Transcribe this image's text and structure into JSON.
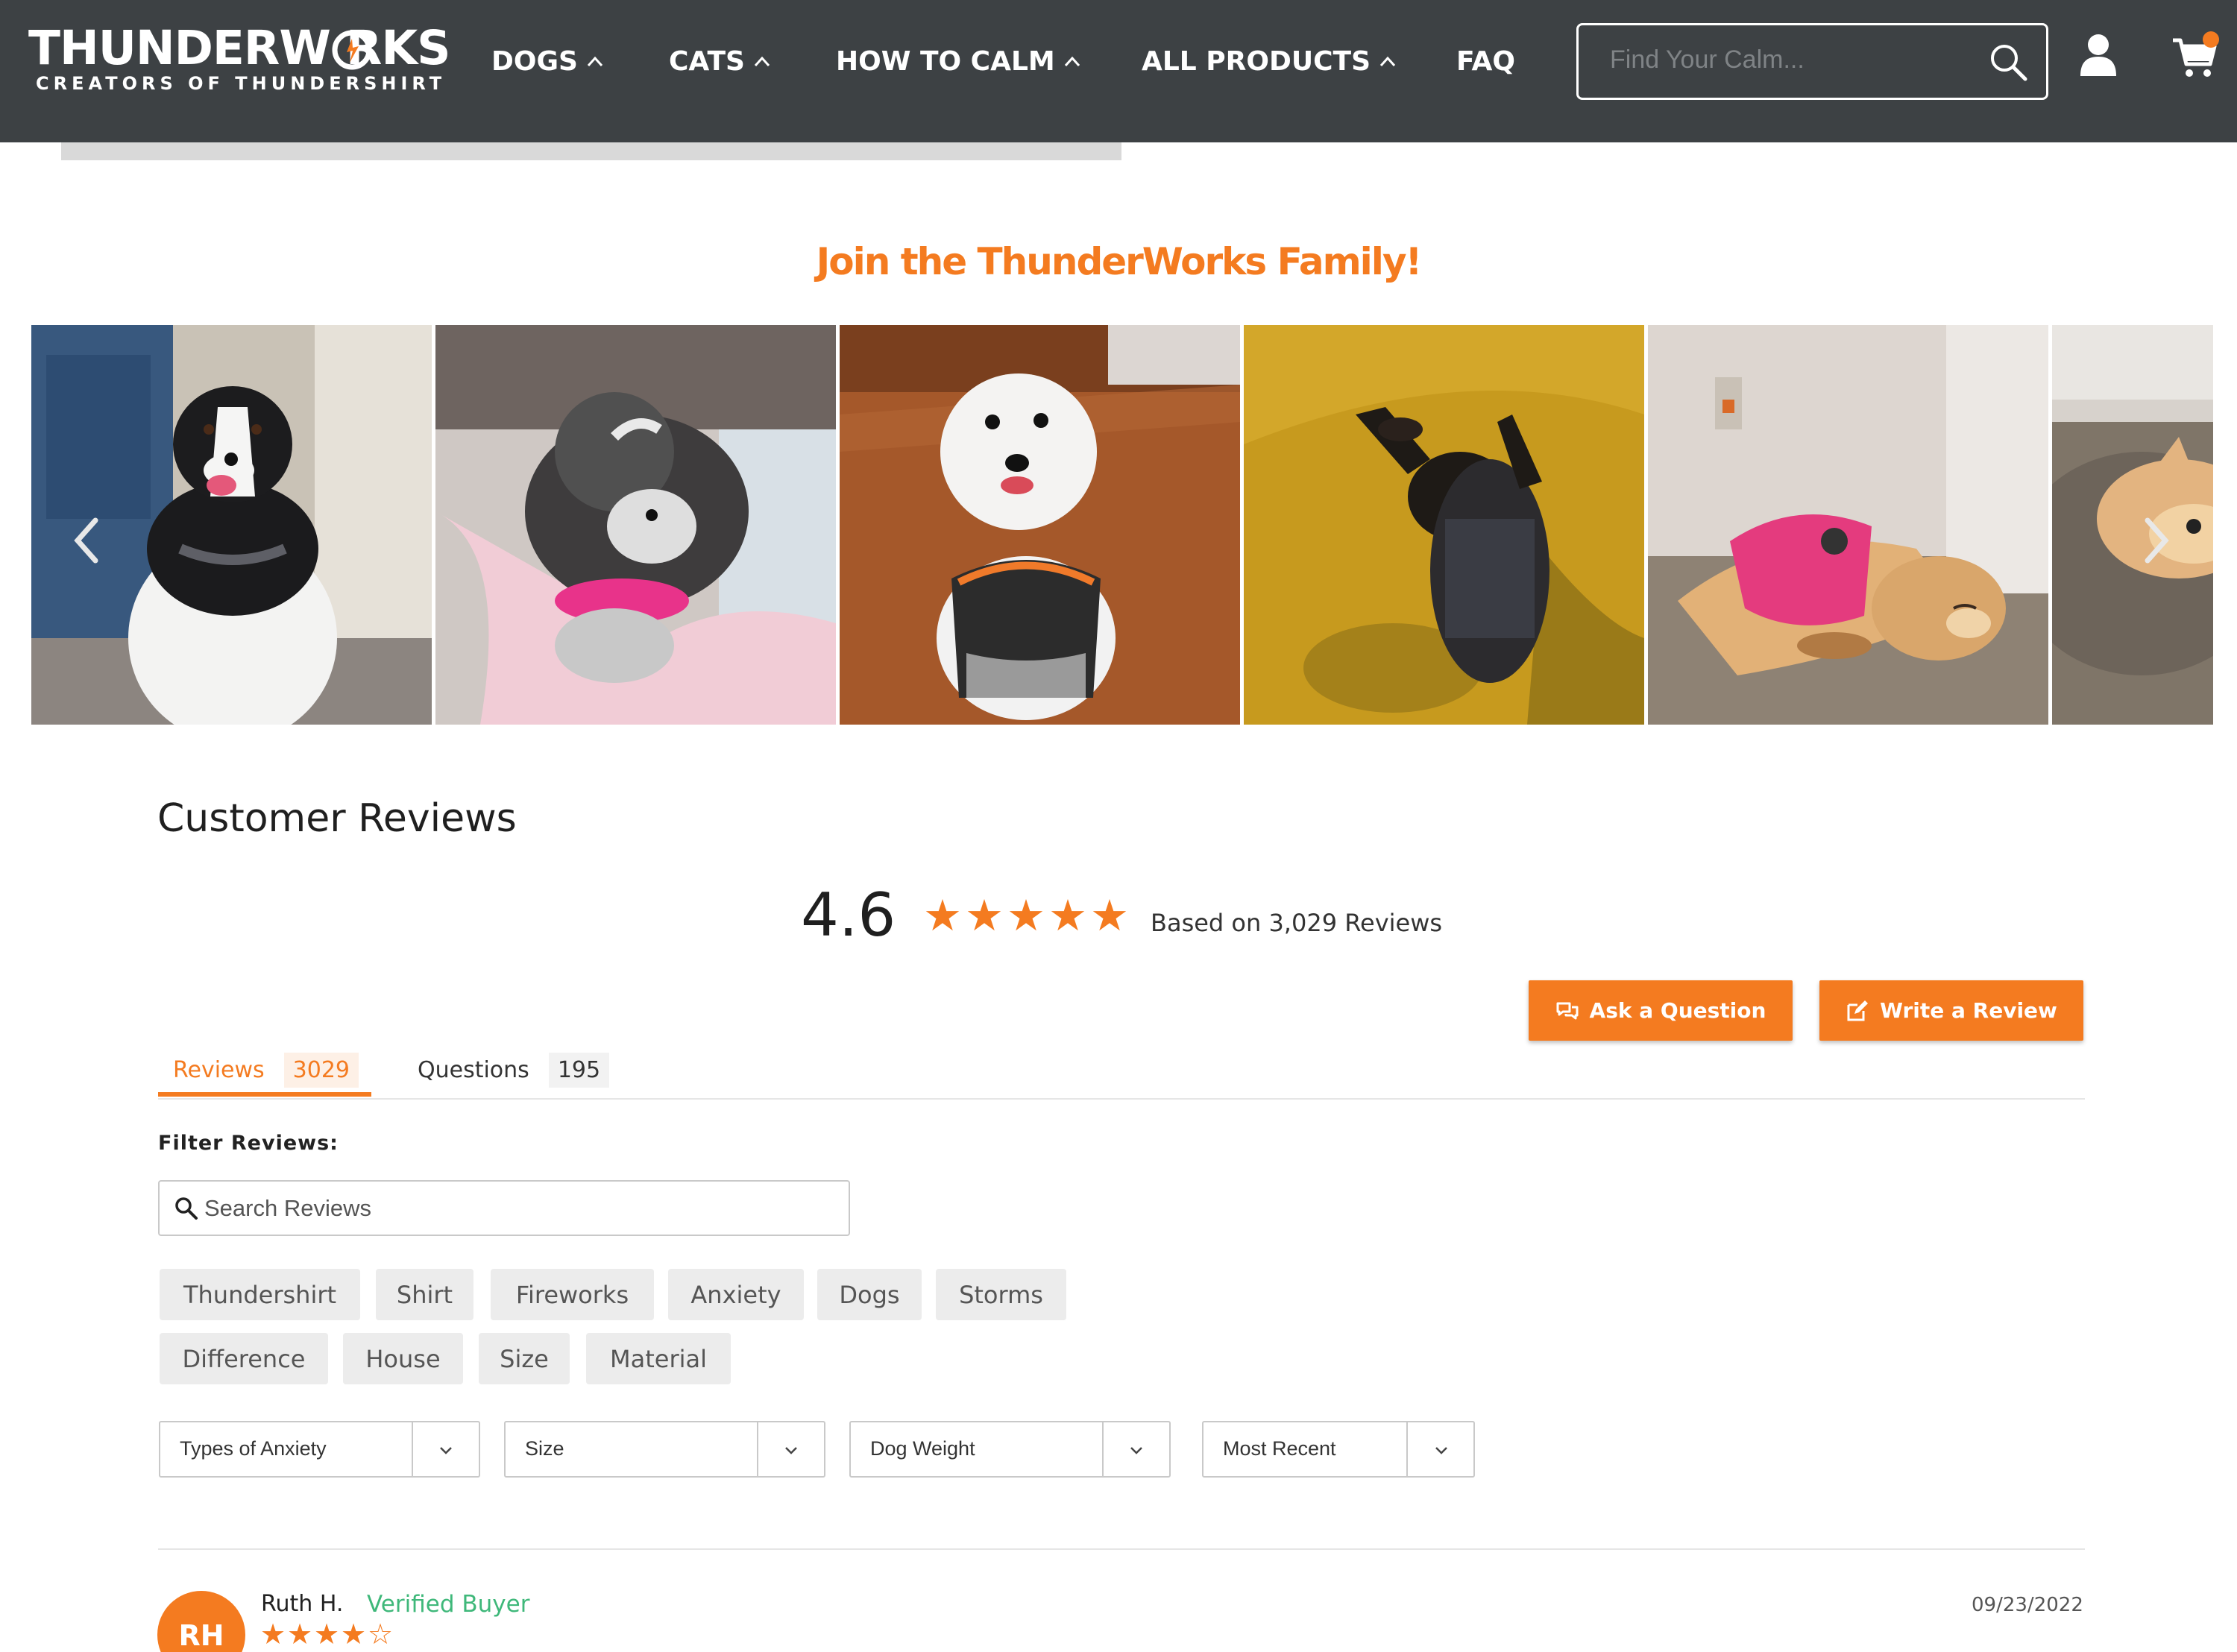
{
  "header": {
    "logo_main": "THUNDERW  RKS",
    "logo_sub": "CREATORS OF THUNDERSHIRT",
    "nav": [
      {
        "label": "DOGS"
      },
      {
        "label": "CATS"
      },
      {
        "label": "HOW TO CALM"
      },
      {
        "label": "ALL PRODUCTS"
      },
      {
        "label": "FAQ"
      }
    ],
    "search_placeholder": "Find Your Calm...",
    "icons": [
      "search-icon",
      "user-icon",
      "cart-icon"
    ]
  },
  "family": {
    "heading": "Join the ThunderWorks Family!",
    "photos": [
      {
        "name": "border-collie-photo"
      },
      {
        "name": "shih-tzu-photo"
      },
      {
        "name": "white-poodle-photo"
      },
      {
        "name": "dachshund-photo"
      },
      {
        "name": "golden-puppy-photo"
      },
      {
        "name": "bulldog-photo"
      }
    ]
  },
  "reviews": {
    "title": "Customer Reviews",
    "rating": "4.6",
    "rating_value": 4.6,
    "rating_stars": [
      "★",
      "★",
      "★",
      "★",
      "★"
    ],
    "based_on": "Based on 3,029 Reviews",
    "ask_button": "Ask a Question",
    "write_button": "Write a Review",
    "tabs": [
      {
        "label": "Reviews",
        "count": "3029"
      },
      {
        "label": "Questions",
        "count": "195"
      }
    ],
    "filter_label": "Filter Reviews:",
    "search_placeholder": "Search Reviews",
    "chips": [
      "Thundershirt",
      "Shirt",
      "Fireworks",
      "Anxiety",
      "Dogs",
      "Storms",
      "Difference",
      "House",
      "Size",
      "Material"
    ],
    "selects": [
      "Types of Anxiety",
      "Size",
      "Dog Weight",
      "Most Recent"
    ],
    "first_review": {
      "initials": "RH",
      "name": "Ruth H.",
      "badge": "Verified Buyer",
      "rating": 4,
      "stars": [
        "★",
        "★",
        "★",
        "★",
        "☆"
      ],
      "date": "09/23/2022"
    }
  },
  "colors": {
    "header_bg": "#3d4144",
    "accent": "#f47b20",
    "verified": "#3fb87a"
  }
}
